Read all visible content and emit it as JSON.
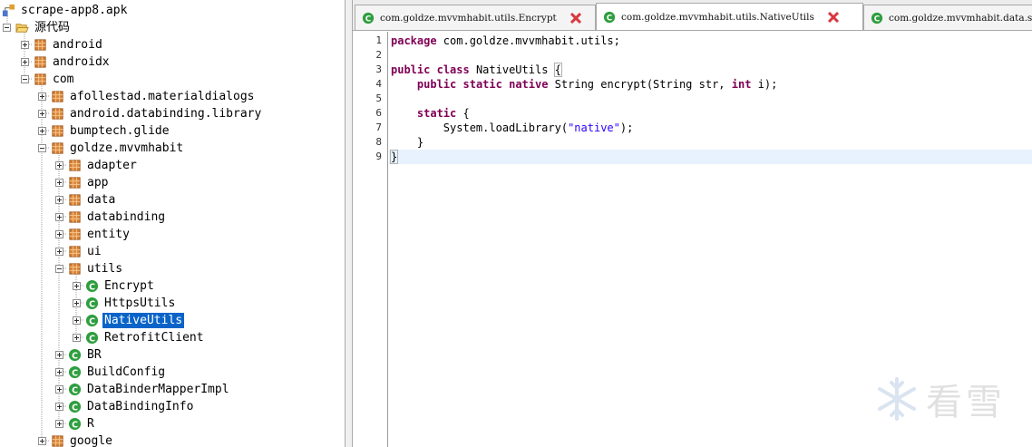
{
  "tree": {
    "root_label": "scrape-app8.apk",
    "source_label": "源代码",
    "nodes": [
      {
        "label": "android",
        "icon": "package-icon",
        "expander": "plus"
      },
      {
        "label": "androidx",
        "icon": "package-icon",
        "expander": "plus"
      },
      {
        "label": "com",
        "icon": "package-icon",
        "expander": "minus"
      },
      {
        "label": "afollestad.materialdialogs",
        "icon": "package-icon",
        "expander": "plus"
      },
      {
        "label": "android.databinding.library",
        "icon": "package-icon",
        "expander": "plus"
      },
      {
        "label": "bumptech.glide",
        "icon": "package-icon",
        "expander": "plus"
      },
      {
        "label": "goldze.mvvmhabit",
        "icon": "package-icon",
        "expander": "minus"
      },
      {
        "label": "adapter",
        "icon": "package-icon",
        "expander": "plus"
      },
      {
        "label": "app",
        "icon": "package-icon",
        "expander": "plus"
      },
      {
        "label": "data",
        "icon": "package-icon",
        "expander": "plus"
      },
      {
        "label": "databinding",
        "icon": "package-icon",
        "expander": "plus"
      },
      {
        "label": "entity",
        "icon": "package-icon",
        "expander": "plus"
      },
      {
        "label": "ui",
        "icon": "package-icon",
        "expander": "plus"
      },
      {
        "label": "utils",
        "icon": "package-icon",
        "expander": "minus"
      },
      {
        "label": "Encrypt",
        "icon": "class-icon",
        "expander": "plus"
      },
      {
        "label": "HttpsUtils",
        "icon": "class-icon",
        "expander": "plus"
      },
      {
        "label": "NativeUtils",
        "icon": "class-icon",
        "expander": "plus",
        "selected": true
      },
      {
        "label": "RetrofitClient",
        "icon": "class-icon",
        "expander": "plus"
      },
      {
        "label": "BR",
        "icon": "class-icon",
        "expander": "plus"
      },
      {
        "label": "BuildConfig",
        "icon": "class-icon",
        "expander": "plus"
      },
      {
        "label": "DataBinderMapperImpl",
        "icon": "class-icon",
        "expander": "plus"
      },
      {
        "label": "DataBindingInfo",
        "icon": "class-icon",
        "expander": "plus"
      },
      {
        "label": "R",
        "icon": "class-icon",
        "expander": "plus"
      },
      {
        "label": "google",
        "icon": "package-icon",
        "expander": "plus"
      }
    ]
  },
  "tabs": [
    {
      "label": "com.goldze.mvvmhabit.utils.Encrypt",
      "active": false
    },
    {
      "label": "com.goldze.mvvmhabit.utils.NativeUtils",
      "active": true
    },
    {
      "label": "com.goldze.mvvmhabit.data.s",
      "active": false
    }
  ],
  "editor": {
    "line_numbers": [
      "1",
      "2",
      "3",
      "4",
      "5",
      "6",
      "7",
      "8",
      "9"
    ],
    "code": {
      "l1_kw": "package",
      "l1_rest": " com.goldze.mvvmhabit.utils;",
      "l3_kw1": "public",
      "l3_kw2": "class",
      "l3_name": " NativeUtils ",
      "l3_brace": "{",
      "l4_kw1": "public",
      "l4_kw2": "static",
      "l4_kw3": "native",
      "l4_mid": " String encrypt(String str, ",
      "l4_kw4": "int",
      "l4_end": " i);",
      "l6_kw": "static",
      "l6_rest": " {",
      "l7_pre": "System.loadLibrary(",
      "l7_str": "\"native\"",
      "l7_post": ");",
      "l8": "}",
      "l9": "}"
    },
    "current_line": 9
  },
  "watermark": {
    "text": "看雪",
    "icon": "snowflake-icon"
  },
  "colors": {
    "keyword": "#7f0055",
    "string": "#2a00ff",
    "selection": "#0a64c8",
    "class_icon": "#2e9e3e",
    "package_icon": "#c9741a",
    "close_icon": "#d9363e"
  }
}
